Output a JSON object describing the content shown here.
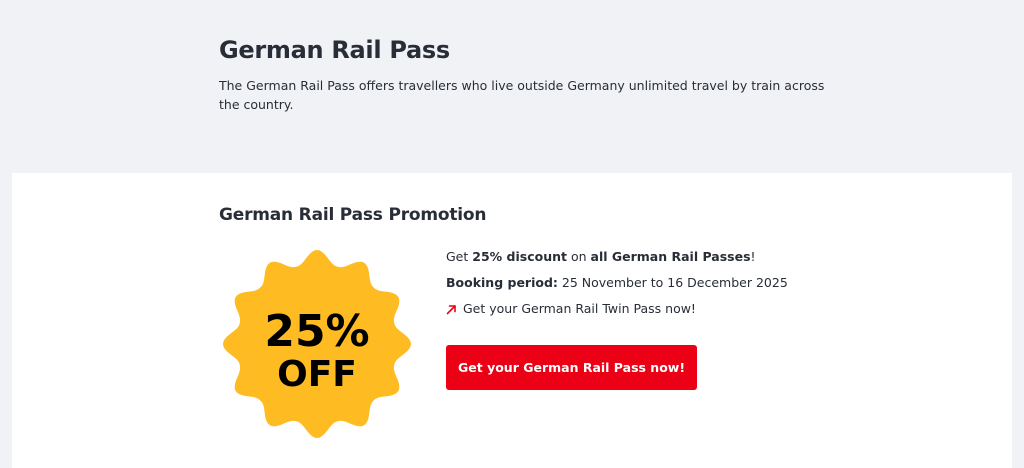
{
  "header": {
    "title": "German Rail Pass",
    "description": "The German Rail Pass offers travellers who live outside Germany unlimited travel by train across the country."
  },
  "promotion": {
    "title": "German Rail Pass Promotion",
    "badge": {
      "line1": "25%",
      "line2": "OFF",
      "color": "#ffbb22"
    },
    "discount_line": {
      "prefix": "Get ",
      "discount": "25% discount",
      "middle": " on ",
      "target": "all German Rail Passes",
      "suffix": "!"
    },
    "booking": {
      "label": "Booking period:",
      "value": " 25 November to 16 December 2025"
    },
    "twin_link": {
      "label": "Get your German Rail Twin Pass now!",
      "icon": "arrow-up-right-icon"
    },
    "cta_label": "Get your German Rail Pass now!",
    "accent_color": "#ec0016"
  }
}
